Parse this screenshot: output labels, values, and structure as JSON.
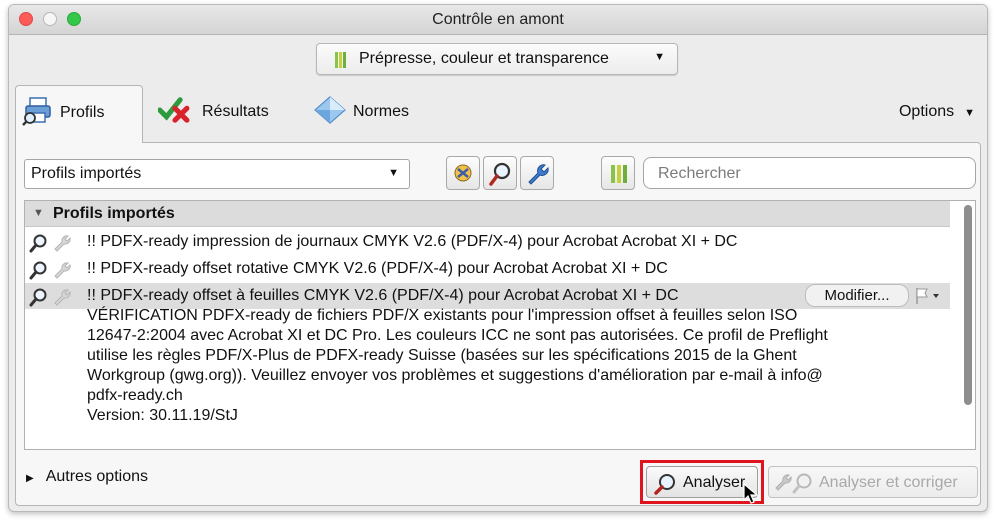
{
  "window": {
    "title": "Contrôle en amont"
  },
  "category": {
    "label": "Prépresse, couleur et transparence"
  },
  "tabs": [
    {
      "label": "Profils"
    },
    {
      "label": "Résultats"
    },
    {
      "label": "Normes"
    }
  ],
  "options": {
    "label": "Options"
  },
  "profile_select": {
    "value": "Profils importés"
  },
  "search": {
    "placeholder": "Rechercher"
  },
  "list": {
    "group": "Profils importés",
    "rows": [
      {
        "text": "!! PDFX-ready impression de journaux CMYK V2.6 (PDF/X-4) pour Acrobat Acrobat XI + DC"
      },
      {
        "text": "!! PDFX-ready offset rotative CMYK V2.6 (PDF/X-4) pour Acrobat Acrobat XI + DC"
      },
      {
        "text": "!! PDFX-ready offset à feuilles CMYK V2.6 (PDF/X-4) pour Acrobat Acrobat XI + DC",
        "selected": true
      }
    ],
    "modify_label": "Modifier...",
    "description": [
      "VÉRIFICATION PDFX-ready de fichiers PDF/X existants pour l'impression offset à feuilles selon ISO",
      "12647-2:2004 avec Acrobat XI et DC Pro. Les couleurs ICC ne sont pas autorisées. Ce profil de Preflight",
      "utilise les règles PDF/X-Plus de PDFX-ready Suisse (basées sur les spécifications 2015 de la Ghent",
      "Workgroup (gwg.org)). Veuillez envoyer vos problèmes et suggestions d'amélioration par e-mail à info@",
      "pdfx-ready.ch",
      "Version: 30.11.19/StJ"
    ]
  },
  "footer": {
    "more_options": "Autres options",
    "analyze": "Analyser",
    "analyze_fix": "Analyser et corriger"
  },
  "colors": {
    "highlight": "#e0141e",
    "traffic_close": "#fc5b57",
    "traffic_max": "#34c84a"
  }
}
